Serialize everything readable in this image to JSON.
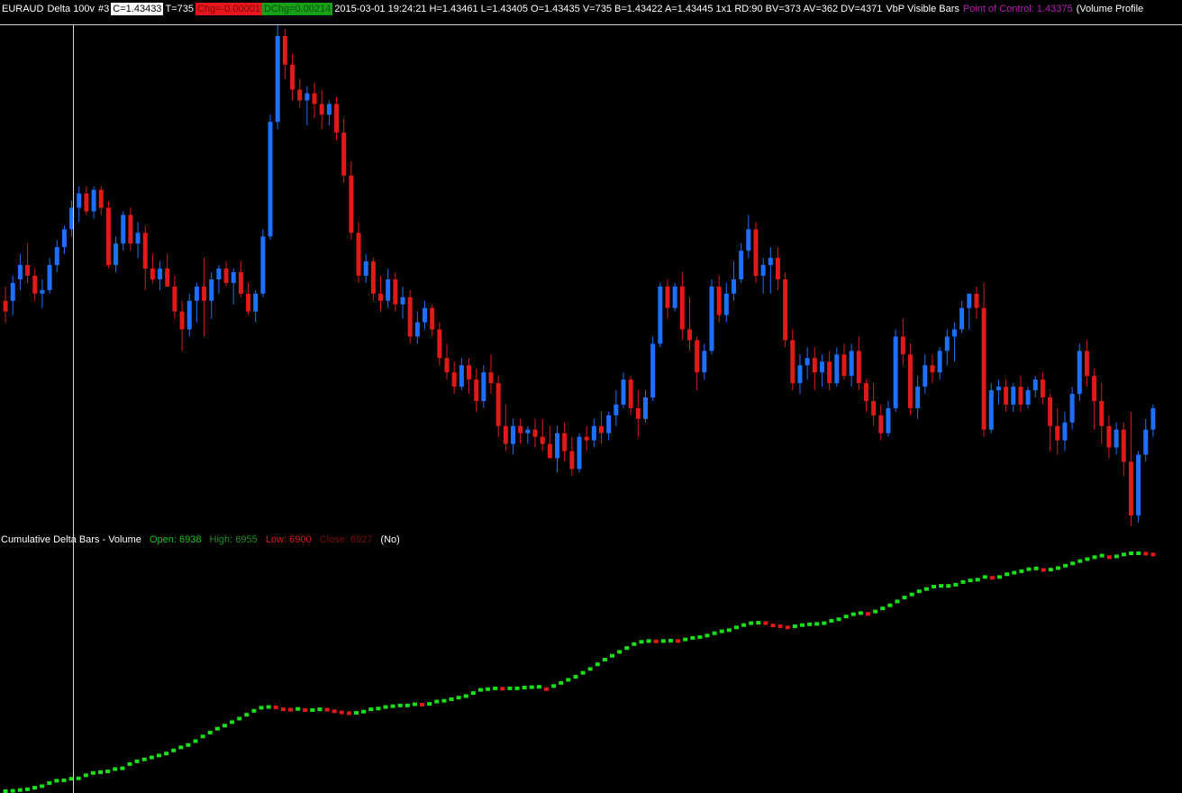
{
  "header": {
    "symbol": "EURAUD",
    "chart_type": "Delta 100v",
    "chart_number": "#3",
    "close": "C=1.43433",
    "trades": "T=735",
    "change": "Chg=-0.00001",
    "daily_change": "DChg=0.00214",
    "info": "2015-03-01 19:24:21 H=1.43461 L=1.43405 O=1.43435 V=735 B=1.43422 A=1.43445 1x1 RD:90 BV=373 AV=362 DV=4371",
    "vbp": "VbP Visible Bars",
    "point_of_control": "Point of Control: 1.43375",
    "volume_profile": "(Volume Profile"
  },
  "study": {
    "name": "Cumulative Delta Bars - Volume",
    "open": "Open: 6938",
    "high": "High: 6955",
    "low": "Low: 6900",
    "close": "Close: 6927",
    "state": "(No)"
  },
  "colors": {
    "up_candle": "#1f6fff",
    "down_candle": "#e01919",
    "delta_up": "#19e019",
    "delta_down": "#e01919",
    "background": "#000000",
    "point_of_control": "#b222b2"
  },
  "chart_data": [
    {
      "type": "candlestick",
      "title": "",
      "candles": [
        [
          1.4328,
          1.4332,
          1.4322,
          1.4325
        ],
        [
          1.4328,
          1.4335,
          1.4324,
          1.4333
        ],
        [
          1.4334,
          1.4341,
          1.4331,
          1.4338
        ],
        [
          1.4338,
          1.4344,
          1.4333,
          1.4335
        ],
        [
          1.4335,
          1.4337,
          1.4328,
          1.433
        ],
        [
          1.433,
          1.4334,
          1.4326,
          1.4331
        ],
        [
          1.4331,
          1.434,
          1.433,
          1.4338
        ],
        [
          1.4338,
          1.4345,
          1.4336,
          1.4343
        ],
        [
          1.4343,
          1.4349,
          1.4341,
          1.4348
        ],
        [
          1.4348,
          1.4356,
          1.4346,
          1.4354
        ],
        [
          1.4354,
          1.436,
          1.435,
          1.4358
        ],
        [
          1.4358,
          1.436,
          1.4352,
          1.4353
        ],
        [
          1.4353,
          1.436,
          1.4351,
          1.4359
        ],
        [
          1.4359,
          1.436,
          1.4352,
          1.4354
        ],
        [
          1.4354,
          1.4356,
          1.4337,
          1.4338
        ],
        [
          1.4338,
          1.4346,
          1.4336,
          1.4344
        ],
        [
          1.4344,
          1.4353,
          1.4342,
          1.4352
        ],
        [
          1.4352,
          1.4354,
          1.4342,
          1.4344
        ],
        [
          1.4344,
          1.435,
          1.434,
          1.4347
        ],
        [
          1.4347,
          1.4349,
          1.4331,
          1.4337
        ],
        [
          1.4337,
          1.4341,
          1.4333,
          1.4334
        ],
        [
          1.4334,
          1.4339,
          1.4331,
          1.4337
        ],
        [
          1.4337,
          1.4341,
          1.4333,
          1.4332
        ],
        [
          1.4332,
          1.4335,
          1.4323,
          1.4325
        ],
        [
          1.4325,
          1.4328,
          1.4314,
          1.432
        ],
        [
          1.432,
          1.433,
          1.4318,
          1.4328
        ],
        [
          1.4328,
          1.4333,
          1.4322,
          1.4332
        ],
        [
          1.4332,
          1.434,
          1.4318,
          1.4328
        ],
        [
          1.4328,
          1.4336,
          1.4323,
          1.4334
        ],
        [
          1.4334,
          1.4338,
          1.433,
          1.4337
        ],
        [
          1.4337,
          1.4339,
          1.4332,
          1.4333
        ],
        [
          1.4333,
          1.4337,
          1.4327,
          1.4336
        ],
        [
          1.4336,
          1.4339,
          1.4329,
          1.433
        ],
        [
          1.433,
          1.4333,
          1.4324,
          1.4325
        ],
        [
          1.4325,
          1.4331,
          1.4322,
          1.433
        ],
        [
          1.433,
          1.4348,
          1.4329,
          1.4346
        ],
        [
          1.4346,
          1.438,
          1.4345,
          1.4378
        ],
        [
          1.4378,
          1.4405,
          1.4376,
          1.4402
        ],
        [
          1.4402,
          1.4404,
          1.439,
          1.4394
        ],
        [
          1.4394,
          1.4397,
          1.4384,
          1.4387
        ],
        [
          1.4387,
          1.439,
          1.4382,
          1.4384
        ],
        [
          1.4384,
          1.4388,
          1.4377,
          1.4386
        ],
        [
          1.4386,
          1.4389,
          1.4379,
          1.4383
        ],
        [
          1.4383,
          1.4387,
          1.4376,
          1.438
        ],
        [
          1.438,
          1.4384,
          1.4377,
          1.4383
        ],
        [
          1.4383,
          1.4385,
          1.4373,
          1.4375
        ],
        [
          1.4375,
          1.4379,
          1.4361,
          1.4363
        ],
        [
          1.4363,
          1.4367,
          1.4345,
          1.4347
        ],
        [
          1.4347,
          1.435,
          1.4333,
          1.4335
        ],
        [
          1.4335,
          1.4341,
          1.4333,
          1.4339
        ],
        [
          1.4339,
          1.434,
          1.4328,
          1.433
        ],
        [
          1.433,
          1.4335,
          1.4325,
          1.4328
        ],
        [
          1.4328,
          1.4337,
          1.4326,
          1.4334
        ],
        [
          1.4334,
          1.4336,
          1.4325,
          1.4327
        ],
        [
          1.4327,
          1.4332,
          1.4323,
          1.4329
        ],
        [
          1.4329,
          1.4331,
          1.4316,
          1.4318
        ],
        [
          1.4318,
          1.4325,
          1.4316,
          1.4322
        ],
        [
          1.4322,
          1.4328,
          1.432,
          1.4326
        ],
        [
          1.4326,
          1.4327,
          1.4318,
          1.432
        ],
        [
          1.432,
          1.4322,
          1.431,
          1.4312
        ],
        [
          1.4312,
          1.4316,
          1.4306,
          1.4308
        ],
        [
          1.4308,
          1.4311,
          1.4302,
          1.4304
        ],
        [
          1.4304,
          1.4312,
          1.4303,
          1.431
        ],
        [
          1.431,
          1.4312,
          1.4302,
          1.4306
        ],
        [
          1.4306,
          1.4309,
          1.4297,
          1.43
        ],
        [
          1.43,
          1.431,
          1.4298,
          1.4308
        ],
        [
          1.4308,
          1.4313,
          1.4302,
          1.4305
        ],
        [
          1.4305,
          1.4307,
          1.429,
          1.4293
        ],
        [
          1.4293,
          1.4299,
          1.4286,
          1.4288
        ],
        [
          1.4288,
          1.4295,
          1.4285,
          1.4293
        ],
        [
          1.4293,
          1.4295,
          1.4288,
          1.4291
        ],
        [
          1.4291,
          1.4293,
          1.4288,
          1.4292
        ],
        [
          1.4292,
          1.4295,
          1.4287,
          1.429
        ],
        [
          1.429,
          1.4295,
          1.4286,
          1.4288
        ],
        [
          1.4288,
          1.4293,
          1.4285,
          1.4284
        ],
        [
          1.4284,
          1.4293,
          1.428,
          1.4291
        ],
        [
          1.4291,
          1.4294,
          1.4283,
          1.4286
        ],
        [
          1.4286,
          1.429,
          1.4279,
          1.4281
        ],
        [
          1.4281,
          1.4291,
          1.428,
          1.429
        ],
        [
          1.429,
          1.4293,
          1.4286,
          1.4289
        ],
        [
          1.4289,
          1.4295,
          1.4287,
          1.4293
        ],
        [
          1.4293,
          1.4297,
          1.4288,
          1.4291
        ],
        [
          1.4291,
          1.4297,
          1.4289,
          1.4296
        ],
        [
          1.4296,
          1.4303,
          1.4293,
          1.4299
        ],
        [
          1.4299,
          1.4308,
          1.4298,
          1.4306
        ],
        [
          1.4306,
          1.4307,
          1.4296,
          1.4298
        ],
        [
          1.4298,
          1.4303,
          1.429,
          1.4295
        ],
        [
          1.4295,
          1.4303,
          1.4294,
          1.4301
        ],
        [
          1.4301,
          1.4318,
          1.43,
          1.4316
        ],
        [
          1.4316,
          1.4333,
          1.4315,
          1.4332
        ],
        [
          1.4332,
          1.4334,
          1.4323,
          1.4326
        ],
        [
          1.4326,
          1.4333,
          1.4325,
          1.4332
        ],
        [
          1.4332,
          1.4336,
          1.4317,
          1.432
        ],
        [
          1.432,
          1.4329,
          1.4314,
          1.4317
        ],
        [
          1.4317,
          1.4318,
          1.4303,
          1.4308
        ],
        [
          1.4308,
          1.4316,
          1.4306,
          1.4314
        ],
        [
          1.4314,
          1.4334,
          1.4313,
          1.4332
        ],
        [
          1.4332,
          1.4335,
          1.4322,
          1.4324
        ],
        [
          1.4324,
          1.4333,
          1.4322,
          1.433
        ],
        [
          1.433,
          1.4339,
          1.4328,
          1.4334
        ],
        [
          1.4334,
          1.4344,
          1.4333,
          1.4342
        ],
        [
          1.4342,
          1.4352,
          1.434,
          1.4348
        ],
        [
          1.4348,
          1.435,
          1.4333,
          1.4335
        ],
        [
          1.4335,
          1.434,
          1.433,
          1.4338
        ],
        [
          1.4338,
          1.4343,
          1.433,
          1.434
        ],
        [
          1.434,
          1.4343,
          1.4331,
          1.4334
        ],
        [
          1.4334,
          1.4336,
          1.4315,
          1.4317
        ],
        [
          1.4317,
          1.432,
          1.4303,
          1.4305
        ],
        [
          1.4305,
          1.4313,
          1.4302,
          1.431
        ],
        [
          1.431,
          1.4315,
          1.4306,
          1.4312
        ],
        [
          1.4312,
          1.4315,
          1.4303,
          1.4308
        ],
        [
          1.4308,
          1.4313,
          1.4304,
          1.4311
        ],
        [
          1.4311,
          1.4314,
          1.4303,
          1.4305
        ],
        [
          1.4305,
          1.4315,
          1.4304,
          1.4313
        ],
        [
          1.4313,
          1.4316,
          1.4306,
          1.4307
        ],
        [
          1.4307,
          1.4316,
          1.4304,
          1.4314
        ],
        [
          1.4314,
          1.4318,
          1.4303,
          1.4305
        ],
        [
          1.4305,
          1.4306,
          1.4297,
          1.43
        ],
        [
          1.43,
          1.4305,
          1.4293,
          1.4296
        ],
        [
          1.4296,
          1.4299,
          1.4289,
          1.4291
        ],
        [
          1.4291,
          1.43,
          1.429,
          1.4298
        ],
        [
          1.4298,
          1.432,
          1.4297,
          1.4318
        ],
        [
          1.4318,
          1.4323,
          1.431,
          1.4313
        ],
        [
          1.4313,
          1.4316,
          1.4296,
          1.4298
        ],
        [
          1.4298,
          1.4307,
          1.4295,
          1.4304
        ],
        [
          1.4304,
          1.4313,
          1.4302,
          1.431
        ],
        [
          1.431,
          1.4313,
          1.4305,
          1.4308
        ],
        [
          1.4308,
          1.4315,
          1.4306,
          1.4314
        ],
        [
          1.4314,
          1.432,
          1.431,
          1.4318
        ],
        [
          1.4318,
          1.4322,
          1.4311,
          1.432
        ],
        [
          1.432,
          1.4328,
          1.4319,
          1.4326
        ],
        [
          1.4326,
          1.4329,
          1.432,
          1.433
        ],
        [
          1.433,
          1.4332,
          1.4323,
          1.4326
        ],
        [
          1.4326,
          1.4333,
          1.429,
          1.4292
        ],
        [
          1.4292,
          1.4305,
          1.4291,
          1.4303
        ],
        [
          1.4303,
          1.4306,
          1.4299,
          1.4304
        ],
        [
          1.4304,
          1.4306,
          1.4297,
          1.4299
        ],
        [
          1.4299,
          1.4305,
          1.4297,
          1.4304
        ],
        [
          1.4304,
          1.4307,
          1.4297,
          1.4299
        ],
        [
          1.4299,
          1.4304,
          1.4298,
          1.4303
        ],
        [
          1.4303,
          1.4307,
          1.4301,
          1.4306
        ],
        [
          1.4306,
          1.4308,
          1.4299,
          1.4301
        ],
        [
          1.4301,
          1.4302,
          1.4286,
          1.4293
        ],
        [
          1.4293,
          1.4298,
          1.4285,
          1.4289
        ],
        [
          1.4289,
          1.4297,
          1.4286,
          1.4294
        ],
        [
          1.4294,
          1.4304,
          1.4292,
          1.4302
        ],
        [
          1.4302,
          1.4316,
          1.43,
          1.4314
        ],
        [
          1.4314,
          1.4317,
          1.4304,
          1.4307
        ],
        [
          1.4307,
          1.4309,
          1.4292,
          1.43
        ],
        [
          1.43,
          1.4305,
          1.4288,
          1.4293
        ],
        [
          1.4293,
          1.4296,
          1.4284,
          1.4287
        ],
        [
          1.4287,
          1.4294,
          1.4285,
          1.4292
        ],
        [
          1.4292,
          1.4294,
          1.4279,
          1.4283
        ],
        [
          1.4283,
          1.4297,
          1.4265,
          1.4268
        ],
        [
          1.4268,
          1.4286,
          1.4266,
          1.4285
        ],
        [
          1.4285,
          1.4295,
          1.4283,
          1.4292
        ],
        [
          1.4292,
          1.4299,
          1.429,
          1.4298
        ]
      ]
    },
    {
      "type": "candlestick",
      "title": "Cumulative Delta Bars - Volume",
      "values": [
        4565,
        4566,
        4568,
        4570,
        4574,
        4578,
        4586,
        4592,
        4593,
        4597,
        4598,
        4606,
        4612,
        4614,
        4616,
        4622,
        4624,
        4635,
        4642,
        4647,
        4652,
        4657,
        4662,
        4670,
        4678,
        4684,
        4694,
        4706,
        4716,
        4726,
        4734,
        4743,
        4752,
        4762,
        4772,
        4780,
        4782,
        4781,
        4776,
        4775,
        4777,
        4774,
        4774,
        4776,
        4775,
        4771,
        4768,
        4766,
        4767,
        4770,
        4776,
        4778,
        4782,
        4784,
        4786,
        4786,
        4789,
        4788,
        4790,
        4796,
        4798,
        4802,
        4806,
        4810,
        4818,
        4826,
        4828,
        4830,
        4829,
        4830,
        4830,
        4832,
        4833,
        4834,
        4828,
        4836,
        4844,
        4852,
        4860,
        4870,
        4880,
        4892,
        4904,
        4914,
        4924,
        4934,
        4944,
        4950,
        4952,
        4951,
        4952,
        4953,
        4952,
        4956,
        4960,
        4962,
        4966,
        4972,
        4977,
        4980,
        4987,
        4993,
        4998,
        4999,
        4998,
        4992,
        4990,
        4987,
        4990,
        4993,
        4995,
        4996,
        4998,
        5004,
        5008,
        5015,
        5021,
        5024,
        5022,
        5028,
        5036,
        5044,
        5054,
        5064,
        5072,
        5080,
        5086,
        5092,
        5094,
        5094,
        5097,
        5104,
        5108,
        5110,
        5117,
        5115,
        5117,
        5124,
        5128,
        5132,
        5137,
        5139,
        5135,
        5136,
        5140,
        5146,
        5152,
        5158,
        5163,
        5168,
        5172,
        5168,
        5170,
        5175,
        5178,
        5178,
        5177,
        5175
      ]
    }
  ]
}
